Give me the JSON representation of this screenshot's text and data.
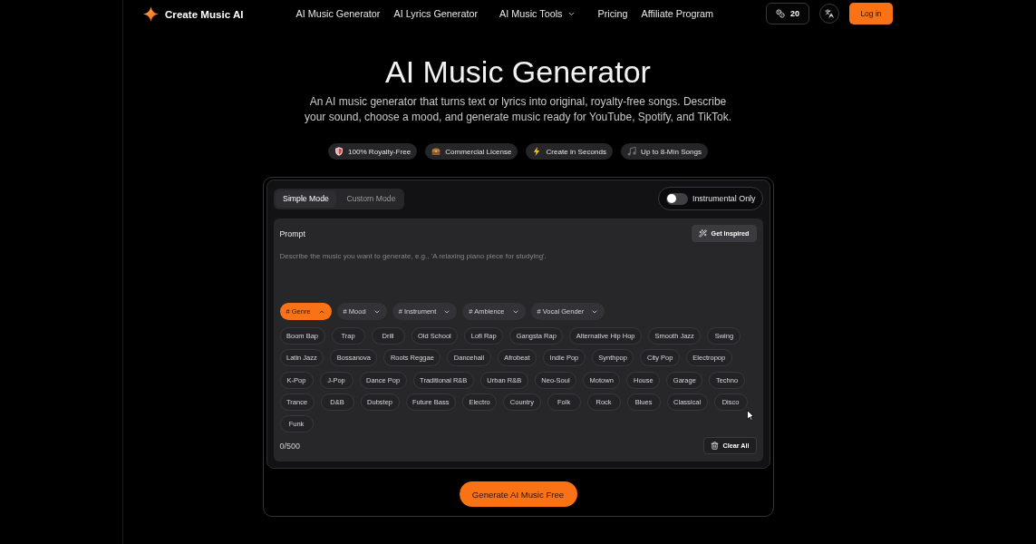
{
  "header": {
    "logo": "Create Music AI",
    "nav": [
      {
        "label": "AI Music Generator",
        "kind": "link"
      },
      {
        "label": "AI Lyrics Generator",
        "kind": "link"
      },
      {
        "label": "AI Music Tools",
        "kind": "menu"
      },
      {
        "label": "Pricing",
        "kind": "link"
      },
      {
        "label": "Affiliate Program",
        "kind": "link"
      }
    ],
    "credits": "20",
    "login_button": "Log in"
  },
  "hero": {
    "title": "AI Music Generator",
    "subtitle": "An AI music generator that turns text or lyrics into original, royalty-free songs. Describe your sound, choose a mood, and generate music ready for YouTube, Spotify, and TikTok.",
    "features": [
      "100% Royalty-Free",
      "Commercial License",
      "Create in Seconds",
      "Up to 8-Min Songs"
    ]
  },
  "generator": {
    "modes": [
      {
        "label": "Simple Mode",
        "selected": true
      },
      {
        "label": "Custom Mode",
        "selected": false
      }
    ],
    "instrumental": {
      "label": "Instrumental Only",
      "on": false
    },
    "prompt": {
      "label": "Prompt",
      "inspire_button": "Get Inspired",
      "placeholder": "Describe the music you want to generate, e.g., 'A relaxing piano piece for studying'.",
      "categories": [
        {
          "label": "# Genre",
          "selected": true,
          "expanded": true
        },
        {
          "label": "# Mood",
          "selected": false,
          "expanded": false
        },
        {
          "label": "# Instrument",
          "selected": false,
          "expanded": false
        },
        {
          "label": "# Ambience",
          "selected": false,
          "expanded": false
        },
        {
          "label": "# Vocal Gender",
          "selected": false,
          "expanded": false
        }
      ],
      "options": [
        "Boom Bap",
        "Trap",
        "Drill",
        "Old School",
        "Lofi Rap",
        "Gangsta Rap",
        "Alternative Hip Hop",
        "Smooth Jazz",
        "Swing",
        "Latin Jazz",
        "Bossanova",
        "Roots Reggae",
        "Dancehall",
        "Afrobeat",
        "Indie Pop",
        "Synthpop",
        "City Pop",
        "Electropop",
        "K-Pop",
        "J-Pop",
        "Dance Pop",
        "Traditional R&B",
        "Urban R&B",
        "Neo-Soul",
        "Motown",
        "House",
        "Garage",
        "Techno",
        "Trance",
        "D&B",
        "Dubstep",
        "Future Bass",
        "Electro",
        "Country",
        "Folk",
        "Rock",
        "Blues",
        "Classical",
        "Disco",
        "Funk"
      ],
      "counter": "0/500",
      "clear_button": "Clear All"
    },
    "submit_button": "Generate AI Music Free"
  }
}
